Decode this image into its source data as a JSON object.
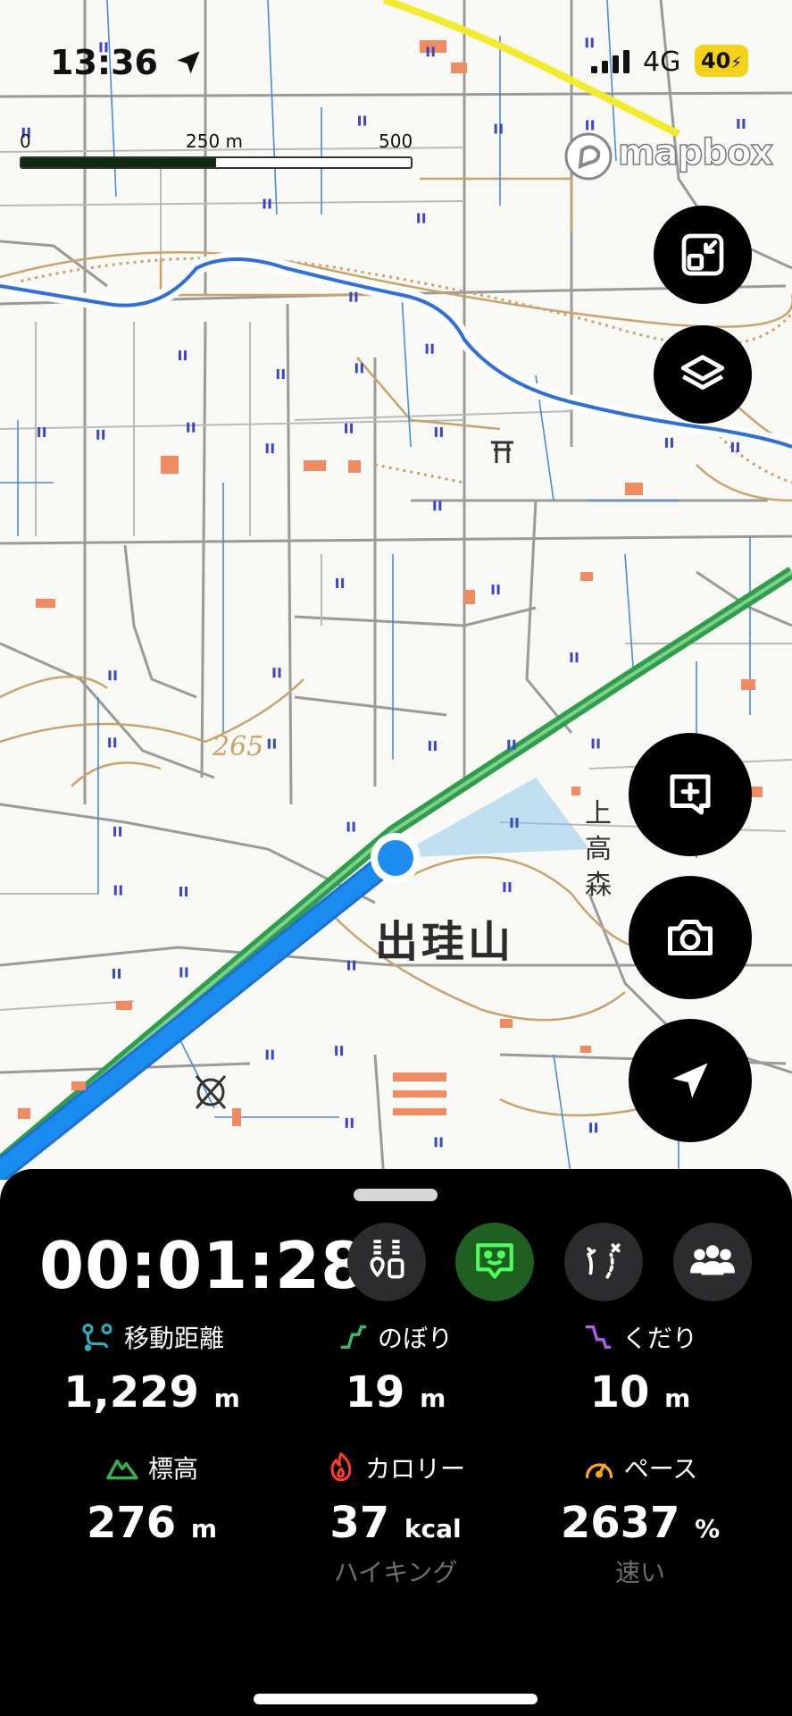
{
  "status_bar": {
    "time": "13:36",
    "network": "4G",
    "battery": "40"
  },
  "map": {
    "scale": {
      "labels": [
        "0",
        "250 m",
        "500 m"
      ]
    },
    "attribution": "mapbox",
    "place_label": "出珪山",
    "vertical_label": "上高森",
    "elevation_label": "265",
    "controls": [
      {
        "name": "collapse-map-button",
        "icon": "collapse-icon"
      },
      {
        "name": "layers-button",
        "icon": "layers-icon"
      },
      {
        "name": "add-memo-button",
        "icon": "add-note-icon"
      },
      {
        "name": "camera-button",
        "icon": "camera-icon"
      },
      {
        "name": "locate-button",
        "icon": "navigation-arrow-icon"
      }
    ]
  },
  "panel": {
    "timer": "00:01:28",
    "action_icons": [
      "route-plan-icon",
      "face-icon",
      "route-compare-icon",
      "group-icon"
    ],
    "stats": [
      {
        "label": "移動距離",
        "value": "1,229",
        "unit": "m",
        "icon": "distance-icon",
        "color": "#27b3c4"
      },
      {
        "label": "のぼり",
        "value": "19",
        "unit": "m",
        "icon": "ascent-icon",
        "color": "#2fbf71"
      },
      {
        "label": "くだり",
        "value": "10",
        "unit": "m",
        "icon": "descent-icon",
        "color": "#b45cf0"
      },
      {
        "label": "標高",
        "value": "276",
        "unit": "m",
        "icon": "mountain-icon",
        "color": "#35b24a"
      },
      {
        "label": "カロリー",
        "value": "37",
        "unit": "kcal",
        "icon": "flame-icon",
        "color": "#ff3b30",
        "sub": "ハイキング"
      },
      {
        "label": "ペース",
        "value": "2637",
        "unit": "%",
        "icon": "speedometer-icon",
        "color": "#f5a623",
        "sub": "速い"
      }
    ]
  }
}
